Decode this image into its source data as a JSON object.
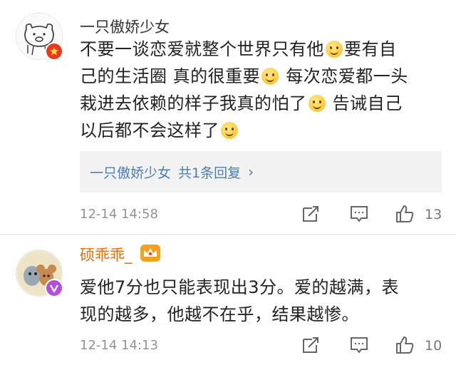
{
  "comments": [
    {
      "username": "一只傲娇少女",
      "lines": [
        [
          "不要一谈恋爱就整个世界只有他",
          "要有自"
        ],
        [
          "己的生活圈 真的很重要",
          " 每次恋爱都一头"
        ],
        [
          "栽进去依赖的样子我真的怕了",
          " 告诫自己"
        ],
        [
          "以后都不会这样了",
          ""
        ]
      ],
      "reply_summary": {
        "author": "一只傲娇少女",
        "count_text": "共1条回复",
        "arrow": "›"
      },
      "timestamp": "12-14 14:58",
      "likes": "13",
      "badge_color": "#e8391e"
    },
    {
      "username": "硕乖乖_",
      "lines": [
        [
          "爱他7分也只能表现出3分。爱的越满，表"
        ],
        [
          "现的越多，他越不在乎，结果越惨。"
        ]
      ],
      "timestamp": "12-14 14:13",
      "likes": "10",
      "username_color": "#e86b0c",
      "badge_color": "#b44fd8"
    }
  ],
  "icons": {
    "emoji": "smile-emoji",
    "share": "share-icon",
    "reply": "comment-icon",
    "like": "thumbs-up-icon"
  }
}
